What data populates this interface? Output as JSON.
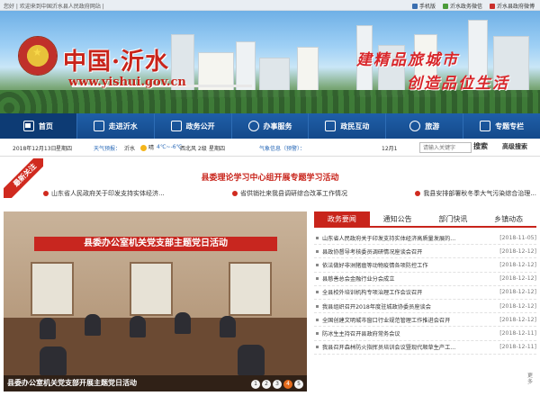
{
  "topbar": {
    "greeting": "您好 | 欢迎来到中国沂水县人民政府网站 |",
    "links": [
      {
        "label": "手机版",
        "icon": "mobile-icon"
      },
      {
        "label": "沂水政务微信",
        "icon": "wechat-icon"
      },
      {
        "label": "沂水县政府微博",
        "icon": "weibo-icon"
      }
    ]
  },
  "banner": {
    "title": "中国·沂水",
    "url": "www.yishui.gov.cn",
    "slogan_line1": "建精品旅城市",
    "slogan_line2": "创造品位生活"
  },
  "nav": [
    {
      "label": "首页",
      "icon": "home-icon"
    },
    {
      "label": "走进沂水",
      "icon": "info-icon"
    },
    {
      "label": "政务公开",
      "icon": "document-icon"
    },
    {
      "label": "办事服务",
      "icon": "user-icon"
    },
    {
      "label": "政民互动",
      "icon": "chat-icon"
    },
    {
      "label": "旅游",
      "icon": "camera-icon"
    },
    {
      "label": "专题专栏",
      "icon": "grid-icon"
    }
  ],
  "infobar": {
    "date": "2018年12月13日",
    "weekday": "星期四",
    "weather_label": "天气预报：",
    "city": "沂水",
    "weather": "晴",
    "temp": "4℃~-6℃",
    "wind": "西北风 2级",
    "day": "星期四",
    "warning_label": "气象信息（预警）：",
    "page_date": "12月1",
    "search_placeholder": "请输入关键字",
    "search_btn": "搜索",
    "advanced": "高级搜索"
  },
  "headline": {
    "ribbon": "最新关注",
    "title": "县委理论学习中心组开展专题学习活动",
    "links": [
      "山东省人民政府关于印发支持实体经济...",
      "省供销社来我县调研综合改革工作情况",
      "我县安排部署秋冬季大气污染综合治理..."
    ]
  },
  "photo": {
    "banner_text": "县委办公室机关党支部主题党日活动",
    "caption": "县委办公室机关党支部开展主题党日活动",
    "pages": [
      "1",
      "2",
      "3",
      "4",
      "5"
    ],
    "active_page": "4"
  },
  "news": {
    "tabs": [
      "政务要闻",
      "通知公告",
      "部门快讯",
      "乡镇动态"
    ],
    "active_tab": "政务要闻",
    "items": [
      {
        "title": "山东省人民政府关于印发支持实体经济高质量发展的...",
        "date": "[2018-11-05]"
      },
      {
        "title": "县政协督导考核委员调研情况座谈会召开",
        "date": "[2018-12-12]"
      },
      {
        "title": "依法做好非洲猪瘟等动物疫情各项防控工作",
        "date": "[2018-12-12]"
      },
      {
        "title": "县慈善总会金融行业分会成立",
        "date": "[2018-12-12]"
      },
      {
        "title": "全县校外培训机构专项治理工作会议召开",
        "date": "[2018-12-12]"
      },
      {
        "title": "我县组织召开2018年度驻城政协委员座谈会",
        "date": "[2018-12-12]"
      },
      {
        "title": "全国创建文明城市窗口行业规范管理工作推进会召开",
        "date": "[2018-12-12]"
      },
      {
        "title": "防冰生主持召开县政府常务会议",
        "date": "[2018-12-11]"
      },
      {
        "title": "我县召开森林防火指挥员培训会议暨现代顺草生产工...",
        "date": "[2018-12-11]"
      }
    ],
    "more": "更多"
  }
}
